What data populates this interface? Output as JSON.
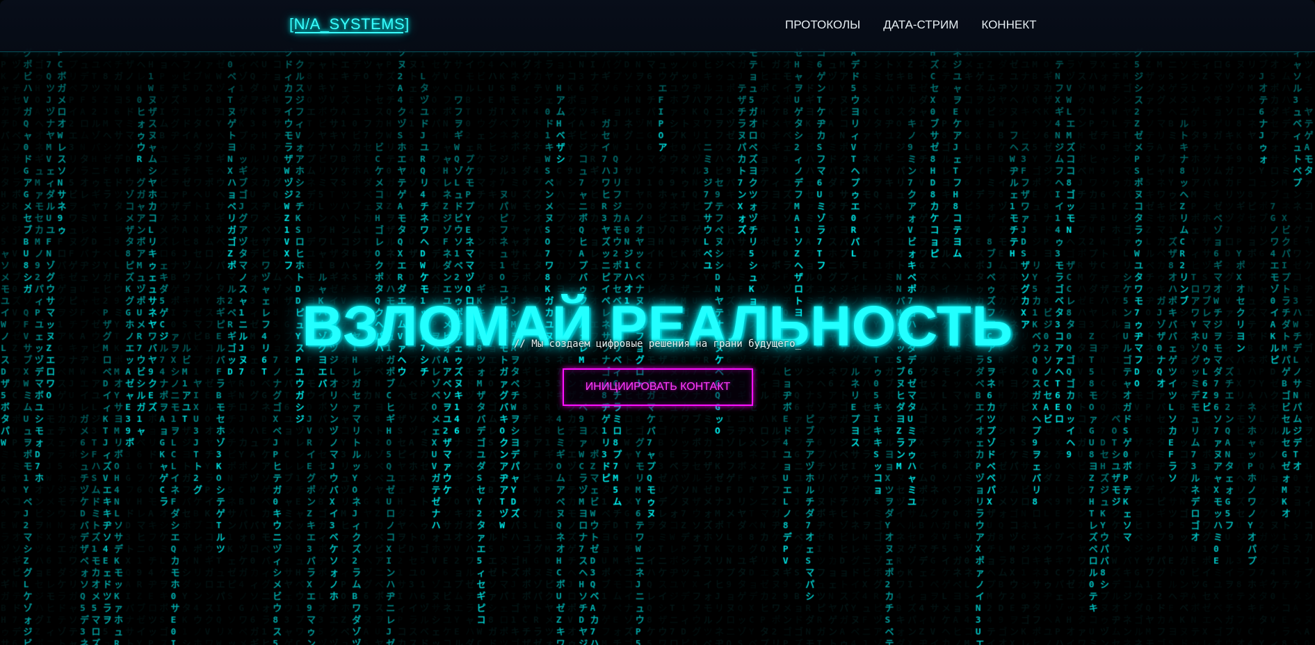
{
  "header": {
    "logo": "[N/A_SYSTEMS]",
    "nav": [
      {
        "label": "ПРОТОКОЛЫ"
      },
      {
        "label": "ДАТА-СТРИМ"
      },
      {
        "label": "КОННЕКТ"
      }
    ]
  },
  "hero": {
    "title": "ВЗЛОМАЙ РЕАЛЬНОСТЬ",
    "subtitle": "// Мы создаем цифровые решения на грани будущего_",
    "cta_label": "ИНИЦИИРОВАТЬ КОНТАКТ"
  },
  "background": {
    "glyphs": "アイウエオカキクケコサシスセソタチツテトナニヌネノハヒフヘホマミムメモヤユヨラリルレロワヲンガギグゲゴザジズゼゾダヂヅデドバビブベボパピプペポァィゥェォャュョッABCDEFGHIJKLMNOPQRSTUVWXYZ0123456789"
  },
  "colors": {
    "background": "#000000",
    "bright_glyph": "#00ffff",
    "dim_glyph": "#0a3a3a",
    "accent_cyan": "#22ffff",
    "accent_magenta": "#ff10ff",
    "nav_text": "#e6eef2"
  }
}
